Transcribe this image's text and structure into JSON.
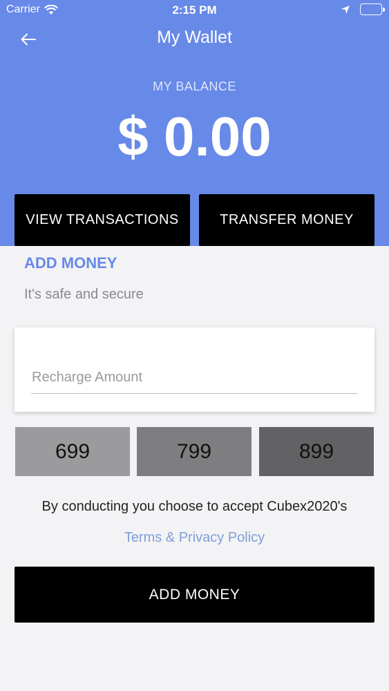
{
  "status_bar": {
    "carrier": "Carrier",
    "time": "2:15 PM"
  },
  "nav": {
    "title": "My Wallet"
  },
  "balance": {
    "label": "MY BALANCE",
    "value": "$ 0.00"
  },
  "actions": {
    "view_transactions": "VIEW TRANSACTIONS",
    "transfer_money": "TRANSFER MONEY"
  },
  "add_money_section": {
    "title": "ADD MONEY",
    "subtitle": "It's safe and secure",
    "amount_placeholder": "Recharge Amount",
    "amount_value": ""
  },
  "quick_amounts": [
    {
      "label": "699",
      "color": "#9b9a9c"
    },
    {
      "label": "799",
      "color": "#7e7d80"
    },
    {
      "label": "899",
      "color": "#626164"
    }
  ],
  "terms": {
    "text": "By conducting you choose to accept Cubex2020's",
    "link": "Terms & Privacy Policy"
  },
  "submit": {
    "label": "ADD MONEY"
  },
  "colors": {
    "header_bg": "#6789e8",
    "accent": "#6789e8",
    "button_bg": "#000000",
    "link": "#7f9ed8"
  }
}
